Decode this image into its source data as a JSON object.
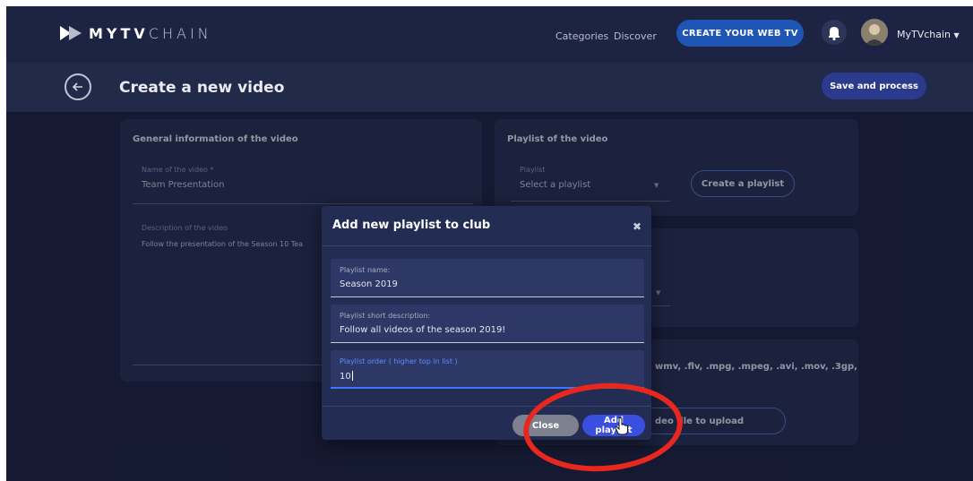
{
  "brand": {
    "logo_pre": "MYTV",
    "logo_post": "CHAIN"
  },
  "nav": {
    "categories": "Categories",
    "discover": "Discover",
    "create_tv": "CREATE YOUR WEB TV",
    "username": "MyTVchain"
  },
  "header": {
    "title": "Create a new video",
    "save": "Save and process"
  },
  "general": {
    "title": "General information of the video",
    "name_label": "Name of the video *",
    "name_value": "Team Presentation",
    "desc_label": "Description of the video",
    "desc_value": "Follow the presentation of the Season 10 Tea"
  },
  "playlist_card": {
    "title": "Playlist of the video",
    "select_label": "Playlist",
    "select_placeholder": "Select a playlist",
    "create_button": "Create a playlist"
  },
  "upload_card": {
    "formats": "wmv, .flv, .mpg, .mpeg, .avi, .mov, .3gp,",
    "button": "deo file to upload"
  },
  "modal": {
    "title": "Add new playlist to club",
    "close_glyph": "✖",
    "fields": [
      {
        "label": "Playlist name:",
        "value": "Season 2019"
      },
      {
        "label": "Playlist short description:",
        "value": "Follow all videos of the season 2019!"
      },
      {
        "label": "Playlist order ( higher top in list )",
        "value": "10"
      }
    ],
    "close_button": "Close",
    "add_button": "Add playlist"
  },
  "colors": {
    "background": "#1c2340",
    "accent": "#1f56b5",
    "primary_button": "#3a4fe0",
    "highlight": "#e8281e"
  },
  "icons": [
    "logo-icon",
    "bell-icon",
    "avatar",
    "dropdown-caret-icon",
    "back-arrow-icon",
    "close-icon",
    "hand-cursor-icon"
  ]
}
